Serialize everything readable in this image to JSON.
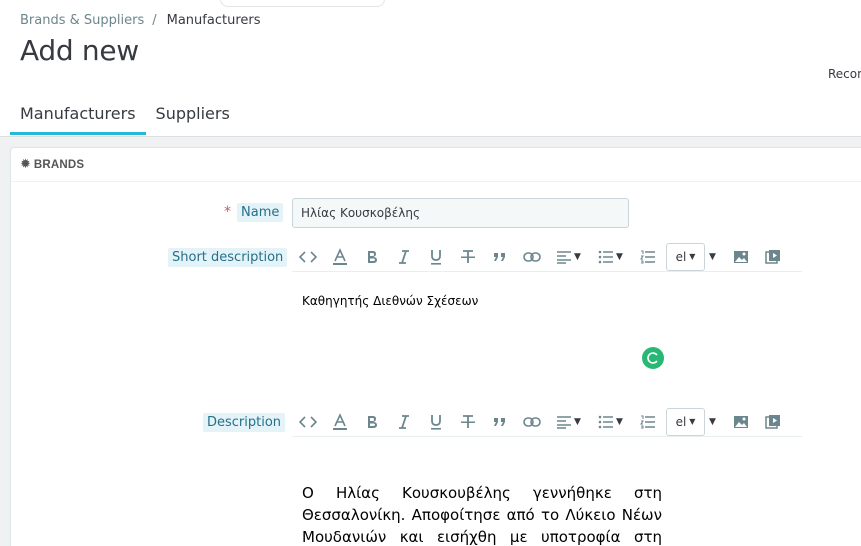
{
  "breadcrumb": {
    "parent": "Brands & Suppliers",
    "separator": "/",
    "current": "Manufacturers"
  },
  "page_title": "Add new",
  "recommended_label": "Recon",
  "tabs": [
    {
      "label": "Manufacturers",
      "active": true
    },
    {
      "label": "Suppliers",
      "active": false
    }
  ],
  "card": {
    "icon": "gear-icon",
    "title": "BRANDS"
  },
  "form": {
    "name": {
      "required_mark": "*",
      "label": "Name",
      "value": "Ηλίας Κουσκοβέλης"
    },
    "short_description": {
      "label": "Short description",
      "content": "Καθηγητής Διεθνών Σχέσεων"
    },
    "description": {
      "label": "Description",
      "content": "Ο Ηλίας Κουσκουβέλης γεννήθηκε στη Θεσσαλονίκη. Αποφοίτησε από το Λύκειο Νέων Μουδανιών και εισήχθη με υποτροφία στη Νομική"
    }
  },
  "toolbar": {
    "language": "el"
  },
  "colors": {
    "accent": "#25b9d7",
    "spinner": "#28b876",
    "label_bg": "#e4f3f7",
    "required": "#c05c67"
  }
}
